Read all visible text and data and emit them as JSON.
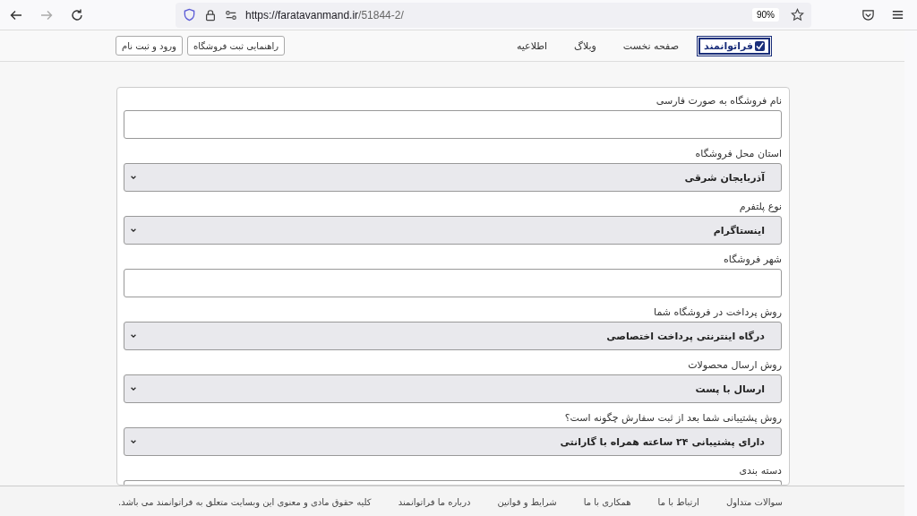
{
  "browser": {
    "url_host": "https://faratavanmand.ir",
    "url_path": "/51844-2/",
    "zoom": "90%",
    "forward_disabled": true
  },
  "header": {
    "logo": "فراتوانمند",
    "nav": [
      "صفحه نخست",
      "وبلاگ",
      "اطلاعیه"
    ],
    "buttons": [
      "راهنمایی ثبت فروشگاه",
      "ورود و ثبت نام"
    ]
  },
  "form": {
    "fields": [
      {
        "label": "نام فروشگاه به صورت فارسی",
        "kind": "text"
      },
      {
        "label": "استان محل فروشگاه",
        "kind": "select",
        "value": "آذربایجان شرقی"
      },
      {
        "label": "نوع پلتفرم",
        "kind": "select",
        "value": "اینستاگرام"
      },
      {
        "label": "شهر فروشگاه",
        "kind": "text"
      },
      {
        "label": "روش پرداخت در فروشگاه شما",
        "kind": "select",
        "value": "درگاه اینترنتی پرداخت اختصاصی"
      },
      {
        "label": "روش ارسال محصولات",
        "kind": "select",
        "value": "ارسال با پست"
      },
      {
        "label": "روش پشتیبانی شما بعد از ثبت سفارش چگونه است؟",
        "kind": "select",
        "value": "دارای پشتیبانی ۲۴ ساعته همراه با گارانتی"
      },
      {
        "label": "دسته بندی",
        "kind": "text"
      }
    ]
  },
  "footer": {
    "links": [
      "سوالات متداول",
      "ارتباط با ما",
      "همکاری با ما",
      "شرایط و قوانین",
      "درباره ما فراتوانمند"
    ],
    "copyright": "کلیه حقوق مادی و معنوی این وبسایت متعلق به فراتوانمند می باشد."
  }
}
